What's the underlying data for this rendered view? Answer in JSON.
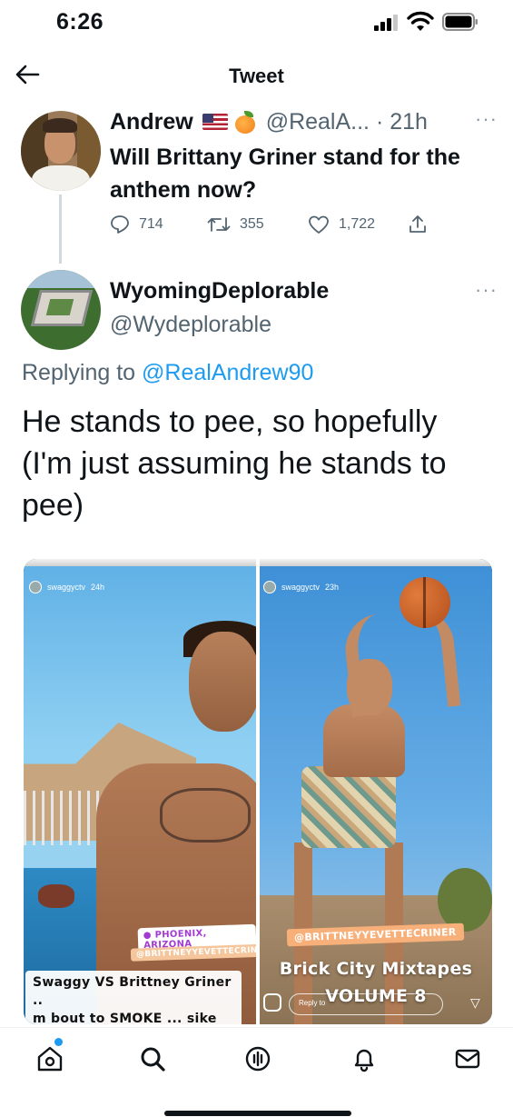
{
  "status_bar": {
    "time": "6:26"
  },
  "header": {
    "title": "Tweet"
  },
  "original_tweet": {
    "author_name": "Andrew",
    "handle_time": "@RealA... · 21h",
    "text": "Will Brittany Griner stand for the anthem now?",
    "replies": "714",
    "retweets": "355",
    "likes": "1,722"
  },
  "reply": {
    "author_name": "WyomingDeplorable",
    "handle": "@Wydeplorable",
    "replying_prefix": "Replying to ",
    "replying_handle": "@RealAndrew90",
    "text": "He stands to pee, so hopefully (I'm just assuming he stands to pee)"
  },
  "media": {
    "left": {
      "story_user": "swaggyctv",
      "story_age": "24h",
      "location_tag": "PHOENIX, ARIZONA",
      "mention_tag": "@BRITTNEYYEVETTECRINER",
      "caption_line1": "Swaggy VS Brittney Griner ..",
      "caption_line2": "m bout to SMOKE ... sike smh"
    },
    "right": {
      "story_user": "swaggyctv",
      "story_age": "23h",
      "mention_tag": "@BRITTNEYYEVETTECRINER",
      "caption_line1": "Brick City Mixtapes",
      "caption_line2": "VOLUME 8",
      "reply_placeholder": "Reply to"
    }
  },
  "bottom_nav": {
    "items": [
      "home",
      "search",
      "spaces",
      "notifications",
      "messages"
    ],
    "notification_dot_color": "#1d9bf0"
  },
  "colors": {
    "link": "#1d9bf0",
    "secondary_text": "#536471",
    "primary_text": "#0f1419"
  }
}
